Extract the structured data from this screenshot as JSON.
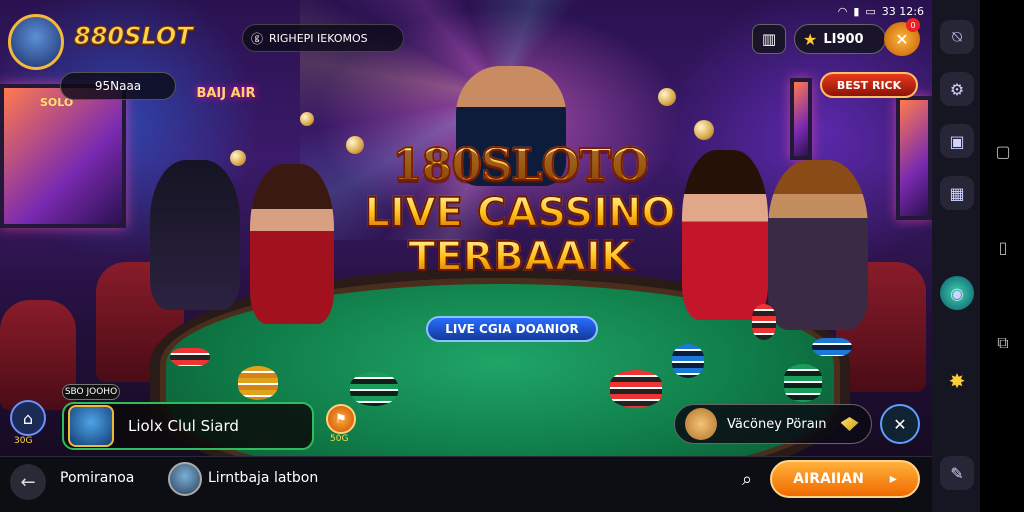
{
  "status_bar": {
    "wifi_icon": "wifi-icon",
    "signal_icon": "signal-icon",
    "battery_icon": "battery-icon",
    "time": "33 12:6"
  },
  "header": {
    "brand": "880SLOT",
    "ticker_text": "RIGHEPI IEKOMOS",
    "username": "95Naaa",
    "balance": "LI900",
    "notification_badge": "0",
    "best_label": "BEST RICK"
  },
  "hero": {
    "brand_title": "180SLOTO",
    "line1": "LIVE CASSINO",
    "line2": "TERBAAIK",
    "subtitle": "LIVE CGIA DOANIOR",
    "sign_text": "BAIJ AIR",
    "tv_label": "SOLO"
  },
  "overlays": {
    "home_label": "30G",
    "tag_label": "SBO JOOHO",
    "player_name": "Liolx Clul Siard",
    "chip_label": "50G",
    "prize_name": "Väcöney Pöraın"
  },
  "bottombar": {
    "left_text": "Pomiranoa",
    "mid_text": "Lirntbaja latbon",
    "cta_label": "AIRAIIAN",
    "cta_arrow": "▸"
  },
  "colors": {
    "accent": "#f06a00",
    "gold": "#ffcc33",
    "felt": "#0f7a47"
  }
}
